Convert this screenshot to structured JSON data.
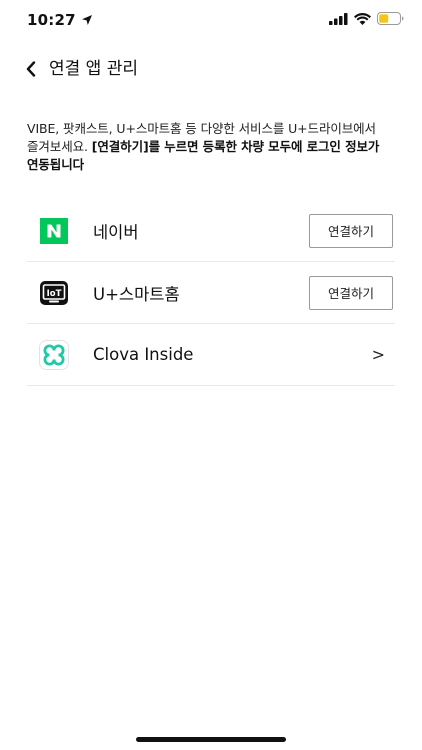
{
  "status_bar": {
    "time": "10:27",
    "battery_color": "#f5c518"
  },
  "header": {
    "title": "연결 앱 관리"
  },
  "description": {
    "normal": "VIBE, 팟캐스트, U+스마트홈 등 다양한 서비스를 U+드라이브에서 즐겨보세요. ",
    "bold": "[연결하기]를 누르면 등록한 차량 모두에 로그인 정보가 연동됩니다"
  },
  "services": [
    {
      "name": "네이버",
      "action": "연결하기",
      "icon": "naver-icon",
      "color": "#03c75a"
    },
    {
      "name": "U+스마트홈",
      "action": "연결하기",
      "icon": "iot-icon",
      "color": "#111111"
    },
    {
      "name": "Clova Inside",
      "action": ">",
      "icon": "clova-icon",
      "color": "#22c9a6"
    }
  ]
}
